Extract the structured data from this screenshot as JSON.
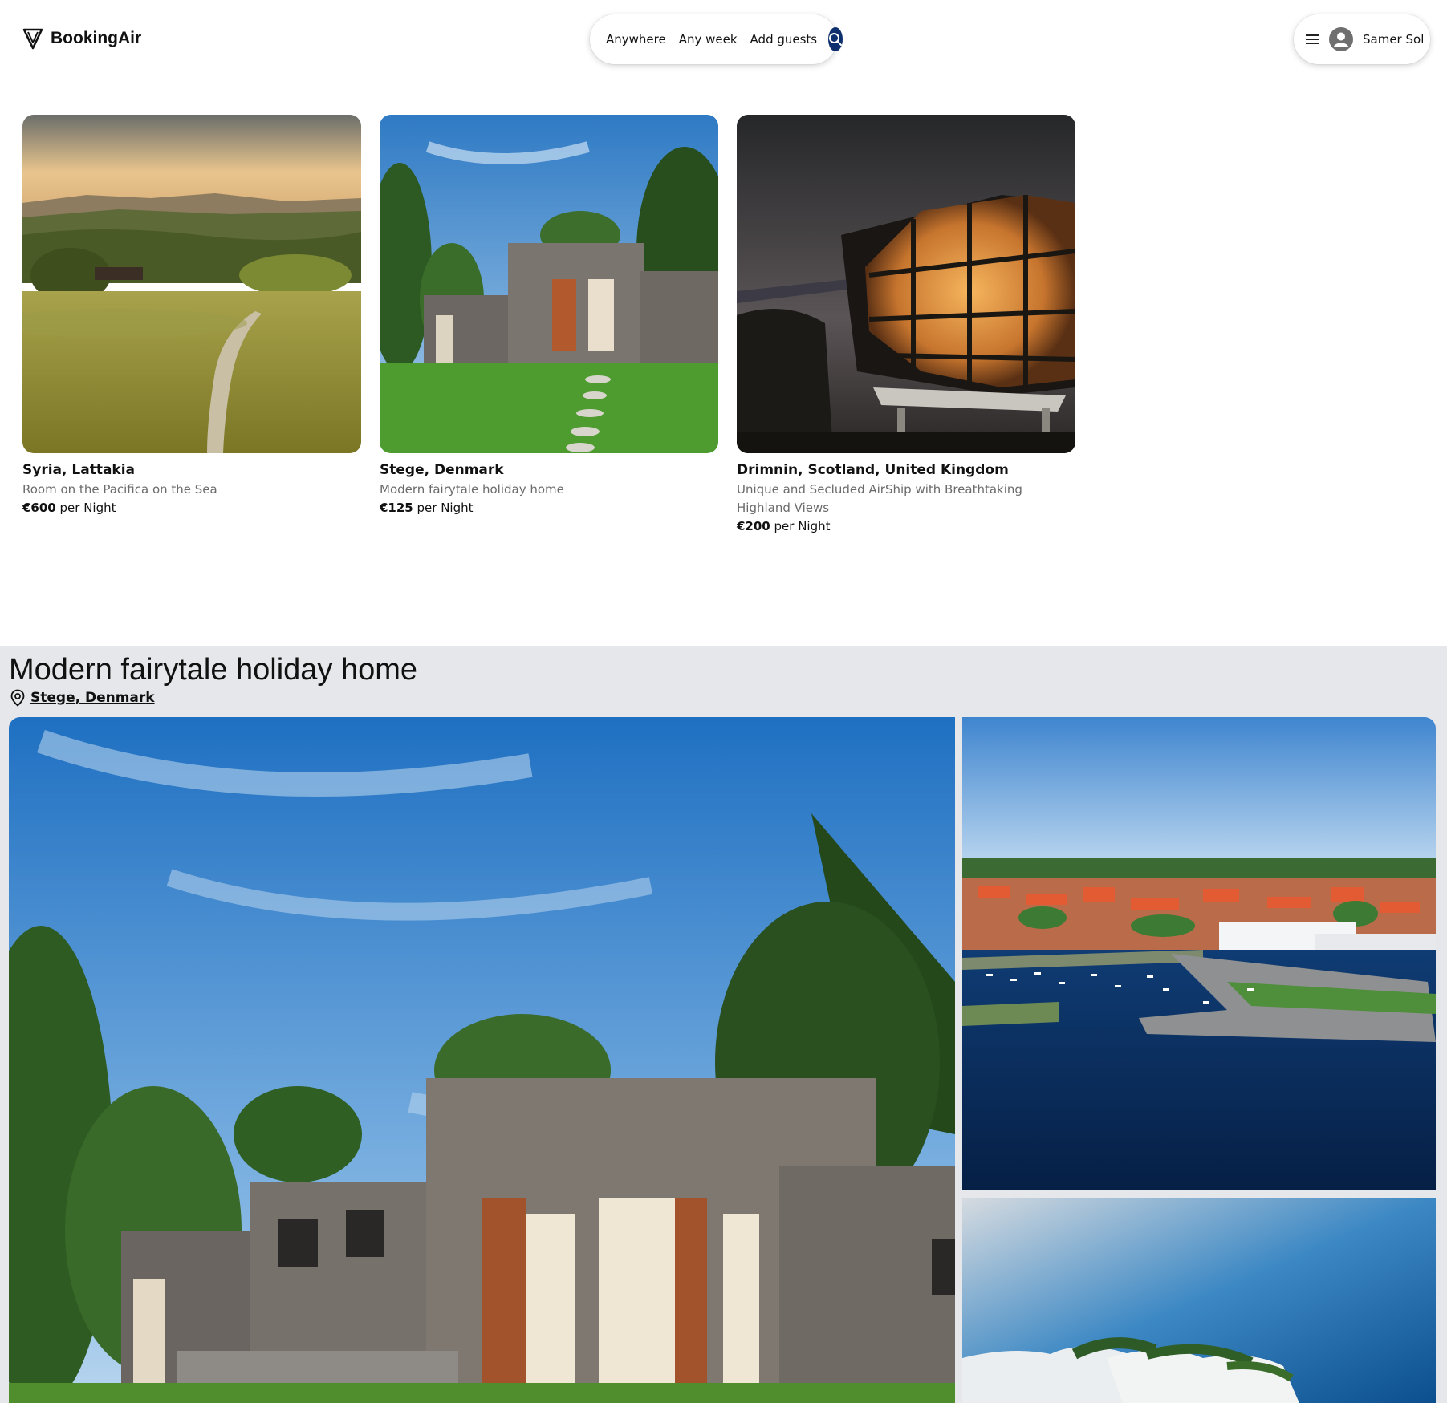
{
  "brand": {
    "name": "BookingAir",
    "accent": "#0d2f6e"
  },
  "search": {
    "location": "Anywhere",
    "dates": "Any week",
    "guests": "Add guests",
    "icon": "search-icon"
  },
  "user": {
    "name": "Samer Sol",
    "menu_icon": "menu-icon",
    "avatar_icon": "avatar-icon"
  },
  "listings": [
    {
      "location": "Syria, Lattakia",
      "description": "Room on the Pacifica on the Sea",
      "price": "€600",
      "price_unit": "per Night"
    },
    {
      "location": "Stege, Denmark",
      "description": "Modern fairytale holiday home",
      "price": "€125",
      "price_unit": "per Night"
    },
    {
      "location": "Drimnin, Scotland, United Kingdom",
      "description": "Unique and Secluded AirShip with Breathtaking Highland Views",
      "price": "€200",
      "price_unit": "per Night"
    }
  ],
  "details": {
    "title": "Modern fairytale holiday home",
    "location": "Stege, Denmark",
    "location_icon": "map-pin-icon",
    "background": "#e6e7ea"
  }
}
